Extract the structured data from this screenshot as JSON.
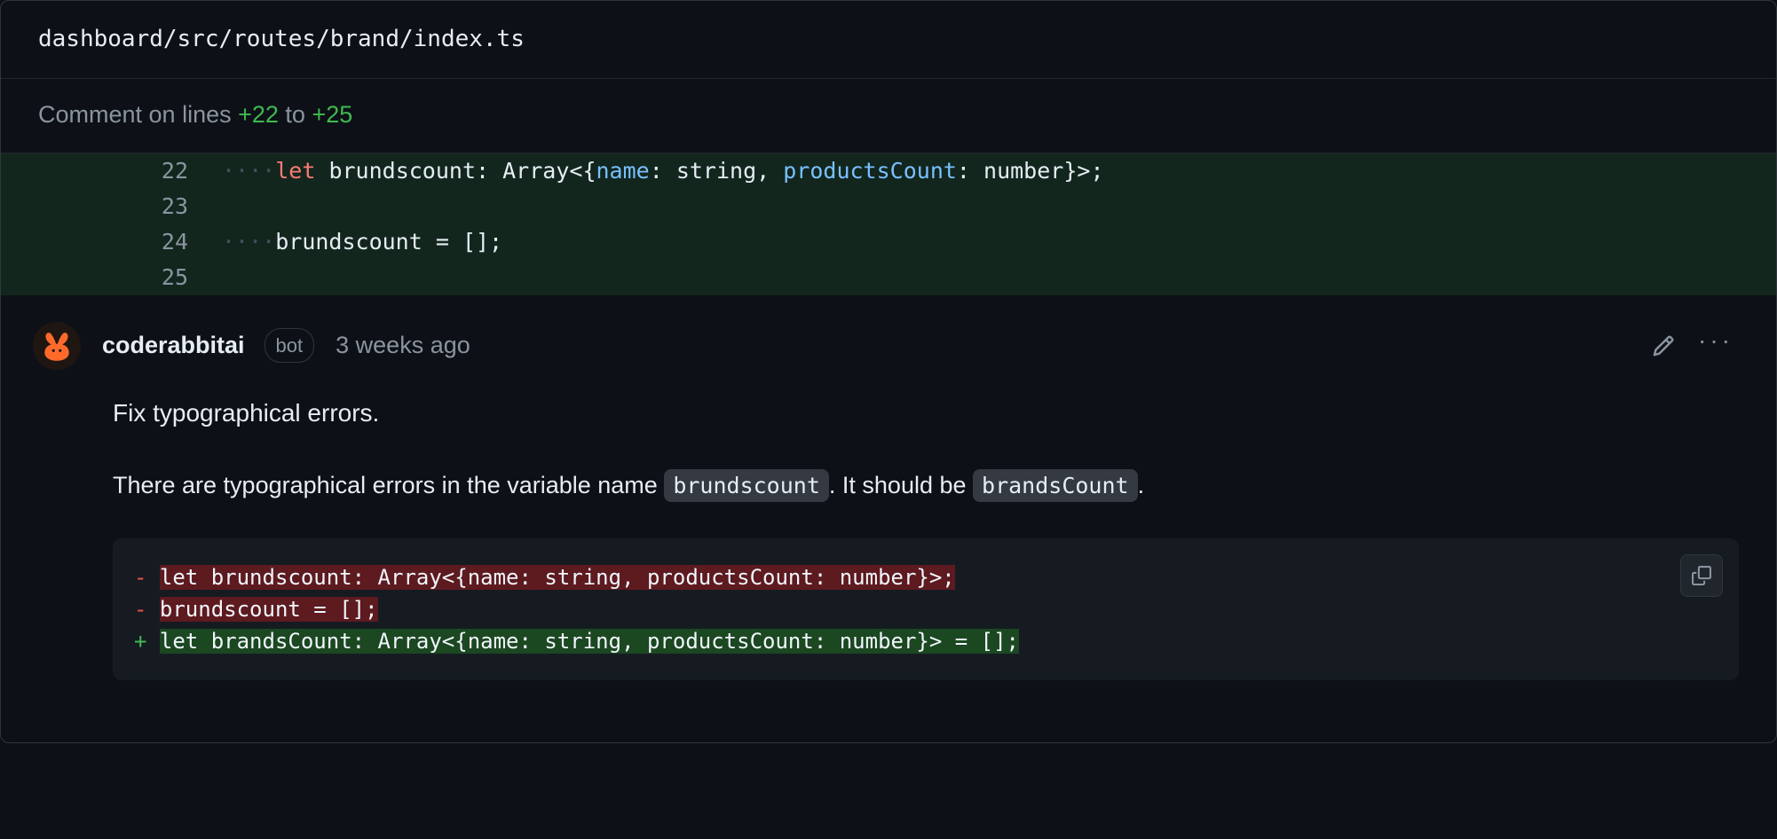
{
  "file_path": "dashboard/src/routes/brand/index.ts",
  "comment_range": {
    "prefix": "Comment on lines ",
    "from": "+22",
    "to_word": " to ",
    "to": "+25"
  },
  "code": {
    "lines": [
      {
        "num": "22",
        "indent_dots": "····",
        "tokens": [
          {
            "cls": "kw-let",
            "t": "let "
          },
          {
            "cls": "ident",
            "t": "brundscount"
          },
          {
            "cls": "punct",
            "t": ": "
          },
          {
            "cls": "type",
            "t": "Array"
          },
          {
            "cls": "punct",
            "t": "<{"
          },
          {
            "cls": "prop",
            "t": "name"
          },
          {
            "cls": "punct",
            "t": ": "
          },
          {
            "cls": "type",
            "t": "string"
          },
          {
            "cls": "punct",
            "t": ", "
          },
          {
            "cls": "prop",
            "t": "productsCount"
          },
          {
            "cls": "punct",
            "t": ": "
          },
          {
            "cls": "type",
            "t": "number"
          },
          {
            "cls": "punct",
            "t": "}>;"
          }
        ]
      },
      {
        "num": "23",
        "indent_dots": "",
        "tokens": []
      },
      {
        "num": "24",
        "indent_dots": "····",
        "tokens": [
          {
            "cls": "ident",
            "t": "brundscount"
          },
          {
            "cls": "punct",
            "t": " = [];"
          }
        ]
      },
      {
        "num": "25",
        "indent_dots": "",
        "tokens": []
      }
    ]
  },
  "comment": {
    "author": "coderabbitai",
    "badge": "bot",
    "timestamp": "3 weeks ago",
    "summary": "Fix typographical errors.",
    "desc_pre": "There are typographical errors in the variable name ",
    "code1": "brundscount",
    "desc_mid": ". It should be ",
    "code2": "brandsCount",
    "desc_post": ".",
    "diff": [
      {
        "type": "del",
        "marker": "- ",
        "text": "let brundscount: Array<{name: string, productsCount: number}>;"
      },
      {
        "type": "del",
        "marker": "- ",
        "text": "brundscount = [];"
      },
      {
        "type": "add",
        "marker": "+ ",
        "text": "let brandsCount: Array<{name: string, productsCount: number}> = [];"
      }
    ]
  },
  "icons": {
    "edit": "edit-icon",
    "more": "more-icon",
    "copy": "copy-icon",
    "avatar": "rabbit-avatar"
  }
}
